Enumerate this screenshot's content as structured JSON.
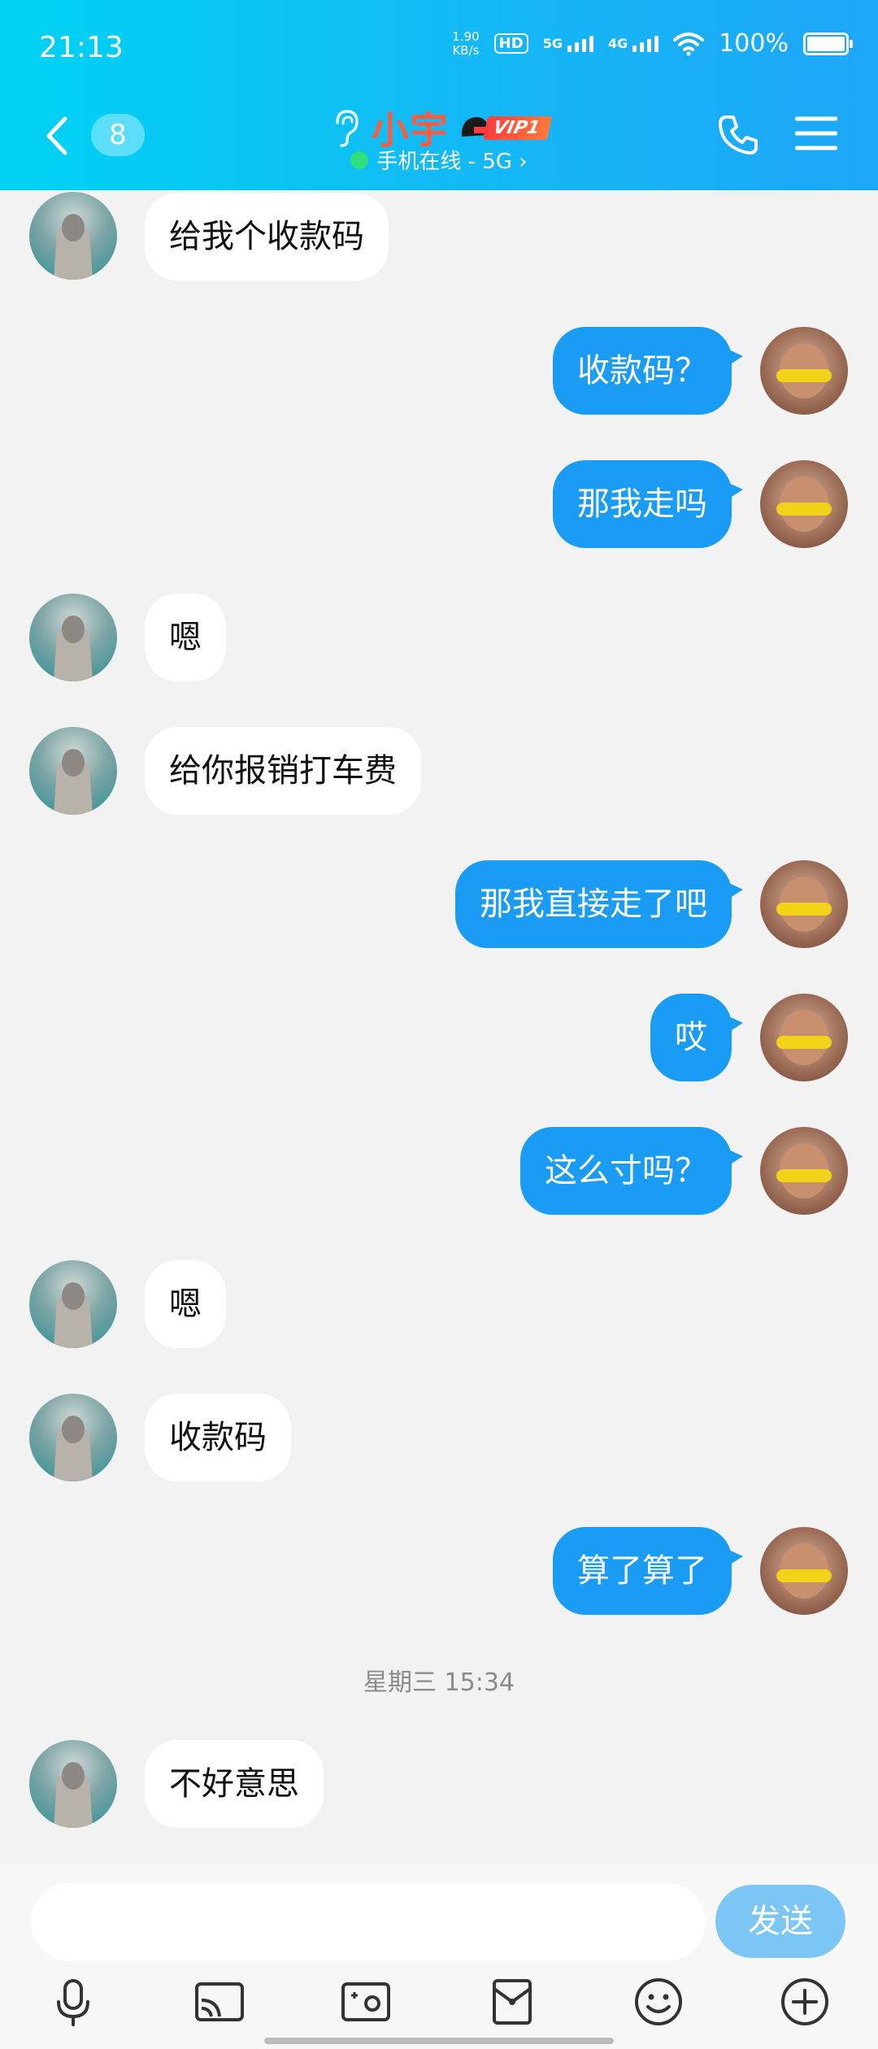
{
  "status_bar": {
    "time": "21:13",
    "net_speed_value": "1.90",
    "net_speed_unit": "KB/s",
    "hd": "HD",
    "sim1": "5G",
    "sim2": "4G",
    "battery": "100%"
  },
  "header": {
    "unread_count": "8",
    "contact_name": "小宇",
    "vip_label": "VIP1",
    "online_status": "手机在线 - 5G ›"
  },
  "messages": [
    {
      "side": "in",
      "text": "给我个收款码"
    },
    {
      "side": "out",
      "text": "收款码？"
    },
    {
      "side": "out",
      "text": "那我走吗"
    },
    {
      "side": "in",
      "text": "嗯"
    },
    {
      "side": "in",
      "text": "给你报销打车费"
    },
    {
      "side": "out",
      "text": "那我直接走了吧"
    },
    {
      "side": "out",
      "text": "哎"
    },
    {
      "side": "out",
      "text": "这么寸吗？"
    },
    {
      "side": "in",
      "text": "嗯"
    },
    {
      "side": "in",
      "text": "收款码"
    },
    {
      "side": "out",
      "text": "算了算了"
    },
    {
      "side": "in",
      "text": "不好意思"
    }
  ],
  "timestamp": "星期三 15:34",
  "input": {
    "value": "",
    "send_label": "发送"
  },
  "toolbar": [
    "mic-icon",
    "screen-share-icon",
    "photo-icon",
    "red-packet-icon",
    "emoji-icon",
    "plus-icon"
  ],
  "colors": {
    "header_start": "#00d2f3",
    "header_end": "#1ea6f8",
    "outgoing_bubble": "#1a9cf4",
    "incoming_bubble": "#ffffff",
    "send_button": "#7cc6f6",
    "name": "#ff5a3c"
  }
}
